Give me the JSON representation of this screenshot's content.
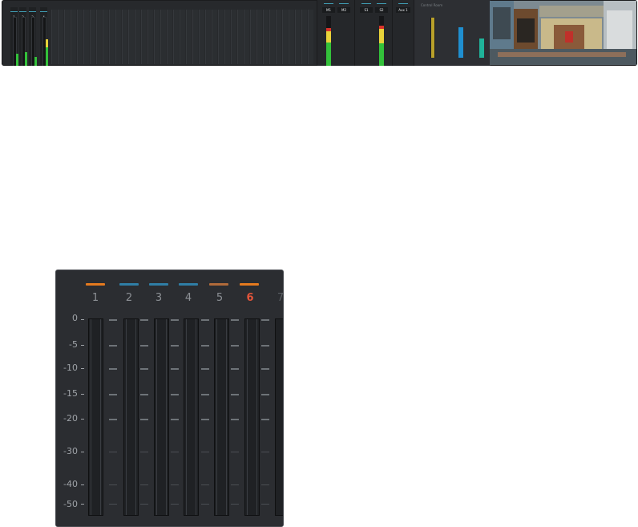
{
  "mixer_strip": {
    "channels": [
      "1",
      "2",
      "3",
      "4"
    ],
    "channel_levels": [
      0.17,
      0.22,
      0.14,
      0.55
    ],
    "buses": [
      {
        "label": "M1",
        "meter": "yellow-green"
      },
      {
        "label": "M2",
        "meter": "none"
      },
      {
        "label": "S1",
        "meter": "none"
      },
      {
        "label": "S2",
        "meter": "yellow-green"
      },
      {
        "label": "Aux 1",
        "meter": "none"
      }
    ],
    "control_room": {
      "title": "Control Room"
    }
  },
  "meter_panel": {
    "channels": [
      {
        "label": "1",
        "color": "#e57a1e",
        "active": false
      },
      {
        "label": "2",
        "color": "#2f7ea6",
        "active": false
      },
      {
        "label": "3",
        "color": "#2f7ea6",
        "active": false
      },
      {
        "label": "4",
        "color": "#2f7ea6",
        "active": false
      },
      {
        "label": "5",
        "color": "#b06a3a",
        "active": false
      },
      {
        "label": "6",
        "color": "#e57a1e",
        "active": true
      },
      {
        "label": "7",
        "color": "",
        "active": false
      }
    ],
    "scale": [
      "0",
      "-5",
      "-10",
      "-15",
      "-20",
      "-30",
      "-40",
      "-50"
    ]
  },
  "colors": {
    "panel_bg": "#2b2d31",
    "active_channel": "#e4553a",
    "meter_green": "#33c13a",
    "meter_yellow": "#e8d33a",
    "meter_red": "#d8322a",
    "meter_blue": "#1f8fd0"
  }
}
